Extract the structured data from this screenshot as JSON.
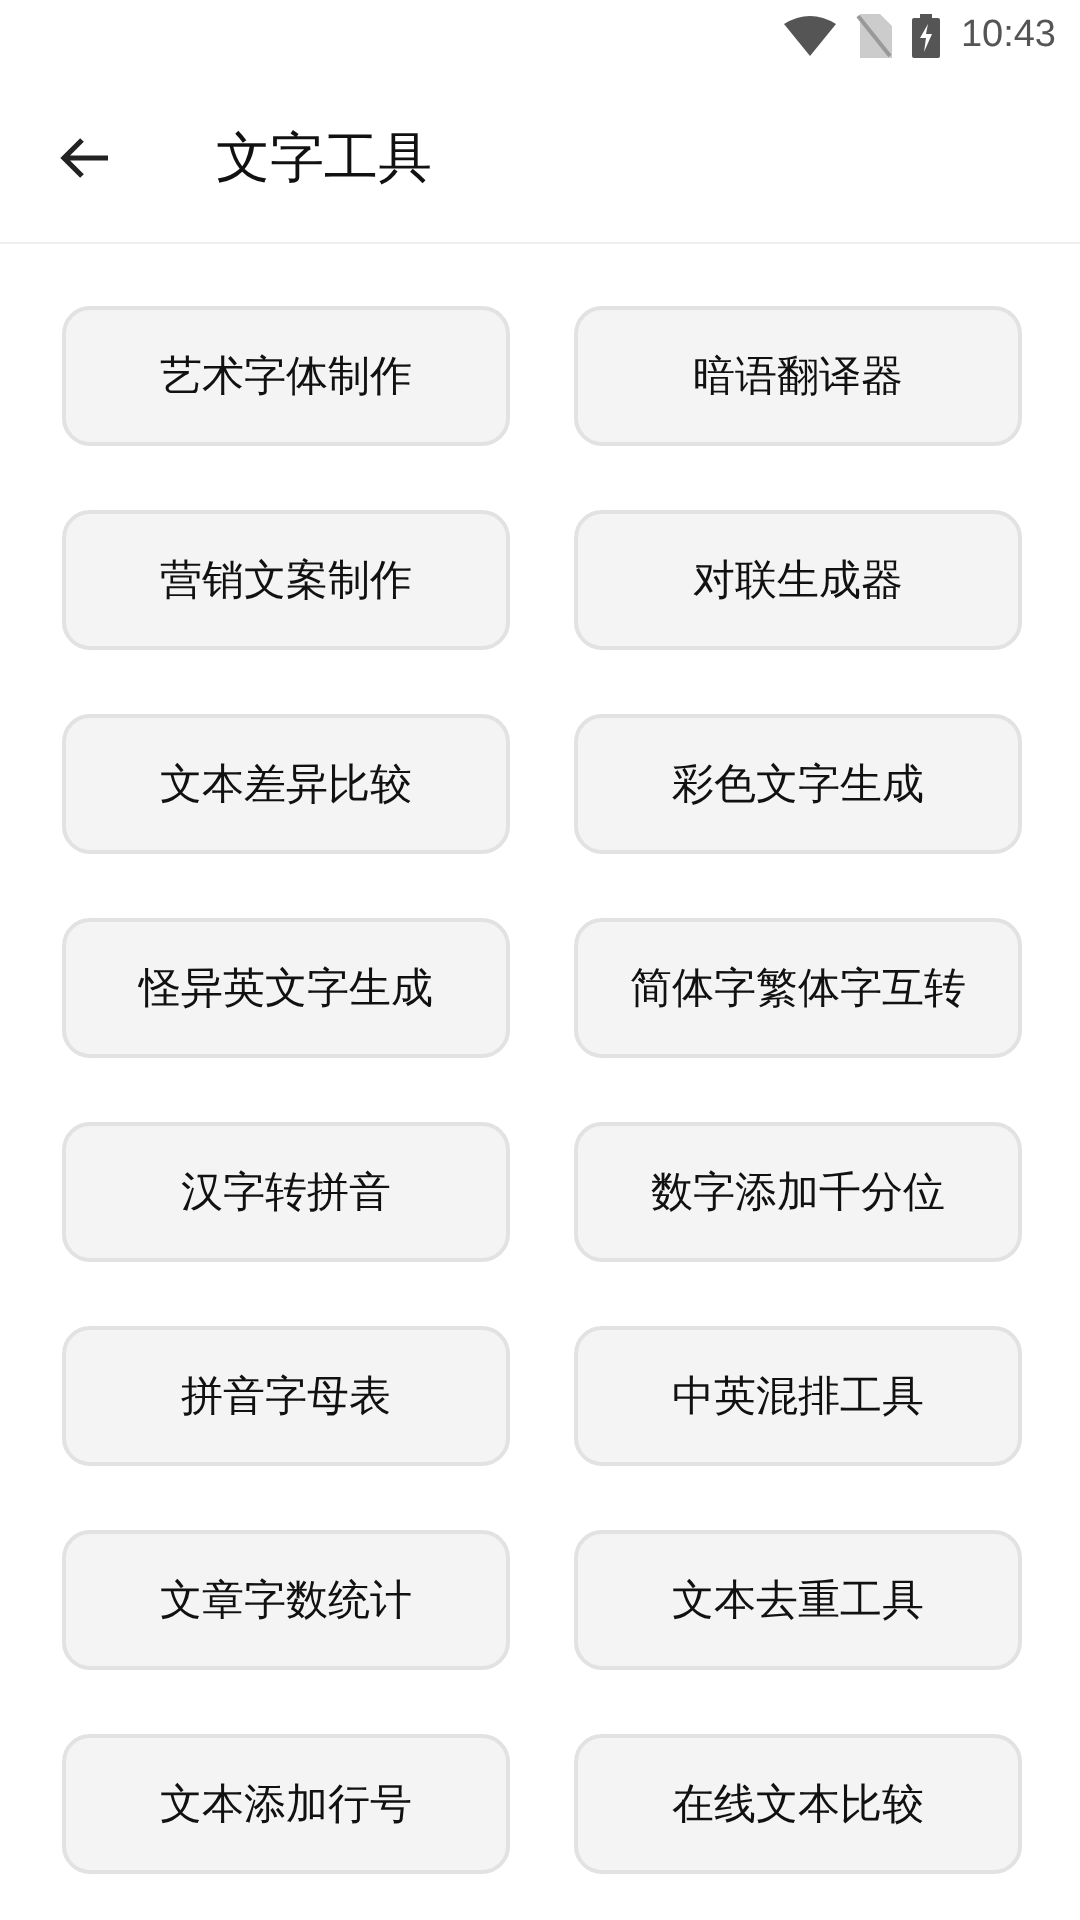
{
  "status_bar": {
    "time": "10:43"
  },
  "header": {
    "title": "文字工具"
  },
  "tools": [
    "艺术字体制作",
    "暗语翻译器",
    "营销文案制作",
    "对联生成器",
    "文本差异比较",
    "彩色文字生成",
    "怪异英文字生成",
    "简体字繁体字互转",
    "汉字转拼音",
    "数字添加千分位",
    "拼音字母表",
    "中英混排工具",
    "文章字数统计",
    "文本去重工具",
    "文本添加行号",
    "在线文本比较"
  ]
}
